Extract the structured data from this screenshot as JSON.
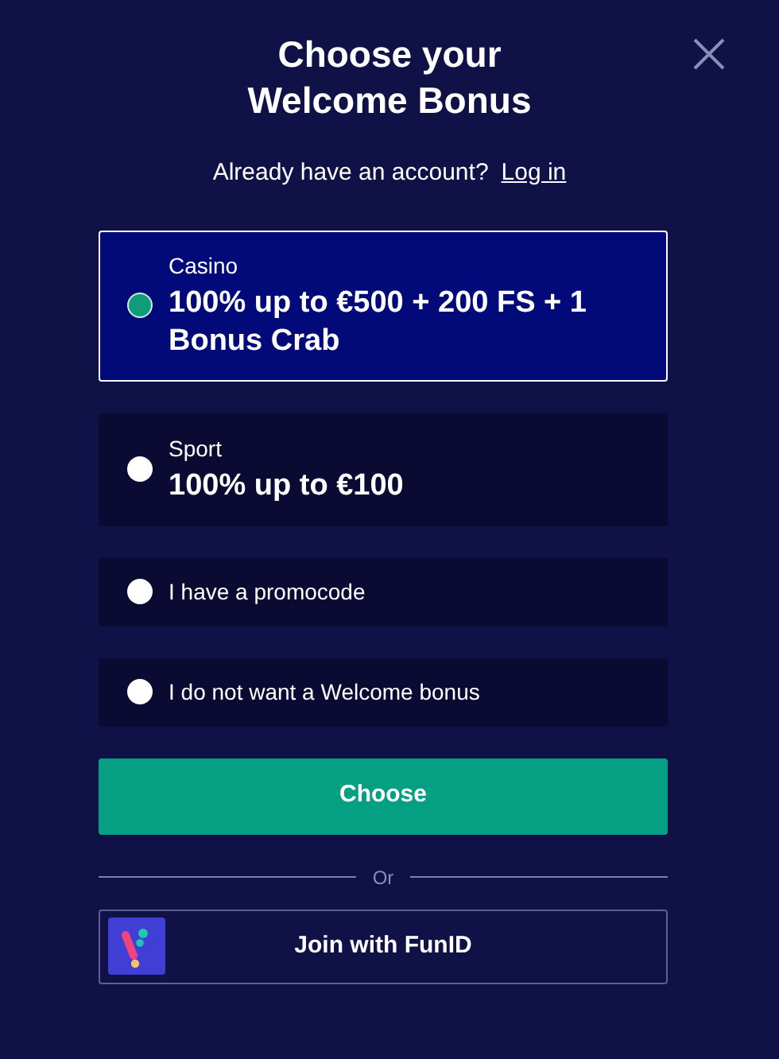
{
  "title": [
    "Choose your",
    "Welcome Bonus"
  ],
  "login": {
    "prompt": "Already have an account?",
    "link": "Log in"
  },
  "options": [
    {
      "kind": "bonus",
      "category": "Casino",
      "label": "100% up to €500 + 200 FS + 1 Bonus Crab",
      "selected": true
    },
    {
      "kind": "bonus",
      "category": "Sport",
      "label": "100% up to €100",
      "selected": false
    },
    {
      "kind": "plain",
      "label": "I have a promocode",
      "selected": false
    },
    {
      "kind": "plain",
      "label": "I do not want a Welcome bonus",
      "selected": false
    }
  ],
  "choose_button": "Choose",
  "divider": "Or",
  "funid_button": "Join with FunID"
}
